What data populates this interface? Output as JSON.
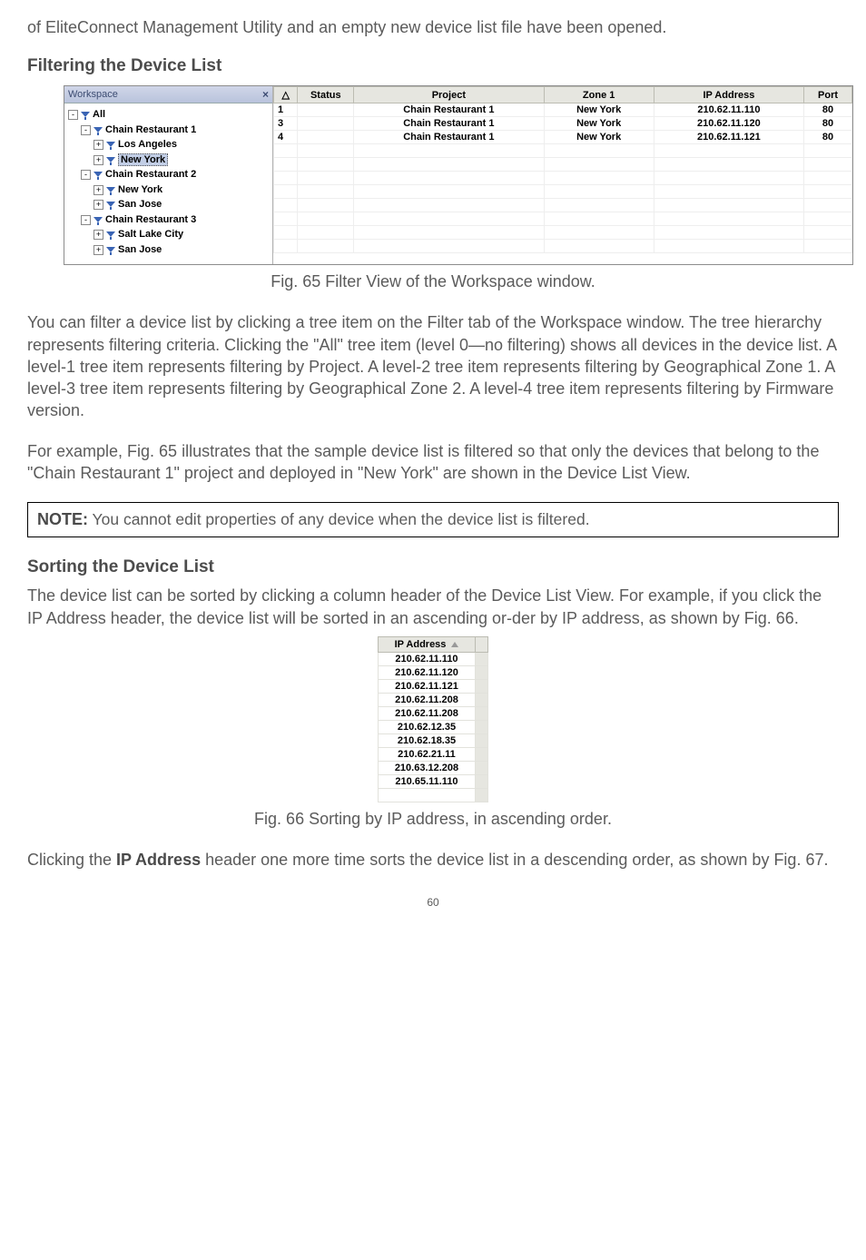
{
  "intro_paragraph": "of EliteConnect Management Utility and an empty new device list file have been opened.",
  "heading_filtering": "Filtering the Device List",
  "fig65": {
    "caption": "Fig. 65 Filter View of the Workspace window.",
    "workspace_title": "Workspace",
    "close": "×",
    "tree": {
      "all": "All",
      "cr1": "Chain Restaurant 1",
      "la": "Los Angeles",
      "ny": "New York",
      "cr2": "Chain Restaurant 2",
      "ny2": "New York",
      "sj": "San Jose",
      "cr3": "Chain Restaurant 3",
      "slc": "Salt Lake City",
      "sj2": "San Jose"
    },
    "headers": {
      "sort": "△",
      "status": "Status",
      "project": "Project",
      "zone1": "Zone 1",
      "ip": "IP Address",
      "port": "Port"
    },
    "rows": [
      {
        "n": "1",
        "project": "Chain Restaurant 1",
        "zone": "New York",
        "ip": "210.62.11.110",
        "port": "80"
      },
      {
        "n": "3",
        "project": "Chain Restaurant 1",
        "zone": "New York",
        "ip": "210.62.11.120",
        "port": "80"
      },
      {
        "n": "4",
        "project": "Chain Restaurant 1",
        "zone": "New York",
        "ip": "210.62.11.121",
        "port": "80"
      }
    ]
  },
  "p_after_fig65a": "You can filter a device list by clicking a tree item on the Filter tab of the Workspace window. The tree hierarchy represents filtering criteria. Clicking the \"All\" tree item (level 0—no filtering) shows all devices in the device list. A level-1 tree item represents filtering by Project. A level-2 tree item represents filtering by Geographical Zone 1. A level-3 tree item represents filtering by Geographical Zone 2. A level-4 tree item represents filtering by Firmware version.",
  "p_after_fig65b": "For example, Fig. 65 illustrates that the sample device list is filtered so that only the devices that belong to the \"Chain Restaurant 1\" project and deployed in \"New York\" are shown in the Device List View.",
  "note_label": "NOTE:",
  "note_text": " You cannot edit properties of any device when the device list is filtered.",
  "heading_sorting": "Sorting the Device List",
  "p_sorting_intro": "The device list can be sorted by clicking a column header of the Device List View. For example, if you click the IP Address header, the device list will be sorted in an ascending or-der by IP address, as shown by Fig. 66.",
  "fig66": {
    "header": "IP Address",
    "caption": "Fig. 66 Sorting by IP address, in ascending order.",
    "ips": [
      "210.62.11.110",
      "210.62.11.120",
      "210.62.11.121",
      "210.62.11.208",
      "210.62.11.208",
      "210.62.12.35",
      "210.62.18.35",
      "210.62.21.11",
      "210.63.12.208",
      "210.65.11.110"
    ]
  },
  "p_click_again_pre": "Clicking the ",
  "p_click_again_bold": "IP Address",
  "p_click_again_post": " header one more time sorts the device list in a descending order, as shown by Fig. 67.",
  "page_num": "60"
}
